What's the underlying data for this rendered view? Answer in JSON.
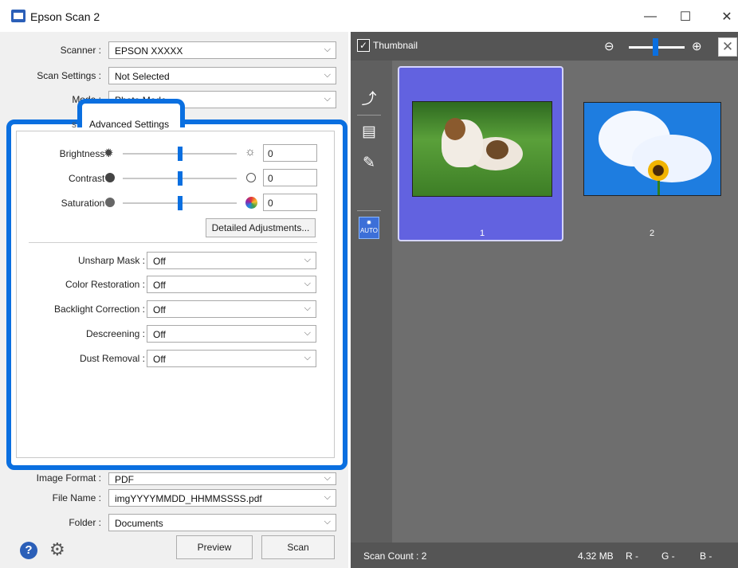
{
  "window": {
    "title": "Epson Scan 2",
    "minimize": "—",
    "maximize": "☐",
    "close": "✕"
  },
  "top_fields": {
    "scanner": {
      "label": "Scanner :",
      "value": "EPSON XXXXX"
    },
    "scan_settings": {
      "label": "Scan Settings :",
      "value": "Not Selected"
    },
    "mode": {
      "label": "Mode :",
      "value": "Photo Mode"
    }
  },
  "tabs": {
    "main_hint": "s",
    "advanced": "Advanced Settings"
  },
  "adjust": {
    "brightness": {
      "label": "Brightness :",
      "value": "0"
    },
    "contrast": {
      "label": "Contrast :",
      "value": "0"
    },
    "saturation": {
      "label": "Saturation :",
      "value": "0"
    },
    "detail_button": "Detailed Adjustments..."
  },
  "options": [
    {
      "label": "Unsharp Mask :",
      "value": "Off"
    },
    {
      "label": "Color Restoration :",
      "value": "Off"
    },
    {
      "label": "Backlight Correction :",
      "value": "Off"
    },
    {
      "label": "Descreening :",
      "value": "Off"
    },
    {
      "label": "Dust Removal :",
      "value": "Off"
    }
  ],
  "bottom_fields": {
    "image_format": {
      "label": "Image Format :",
      "value": "PDF"
    },
    "file_name": {
      "label": "File Name :",
      "value": "imgYYYYMMDD_HHMMSSSS.pdf"
    },
    "folder": {
      "label": "Folder :",
      "value": "Documents"
    }
  },
  "buttons": {
    "preview": "Preview",
    "scan": "Scan"
  },
  "preview": {
    "thumbnail_label": "Thumbnail",
    "thumbnail_checked": true,
    "thumbs": [
      {
        "number": "1",
        "selected": true
      },
      {
        "number": "2",
        "selected": false
      }
    ]
  },
  "status": {
    "scan_count": "Scan Count : 2",
    "size": "4.32 MB",
    "r": "R  -",
    "g": "G  -",
    "b": "B  -"
  },
  "colors": {
    "accent": "#0a6fe0",
    "selected_thumb": "#6262e0",
    "panel_gray": "#6e6e6e"
  },
  "icons": [
    "app-icon",
    "help-icon",
    "gear-icon",
    "zoom-out-icon",
    "zoom-in-icon",
    "rotate-icon",
    "document-icon",
    "auto-correct-icon"
  ]
}
